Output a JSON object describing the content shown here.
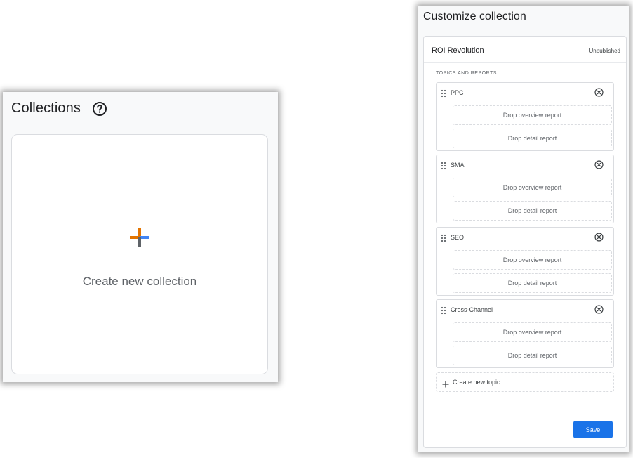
{
  "collections_panel": {
    "title": "Collections",
    "help_icon": "help-circle-icon",
    "create_card": {
      "label": "Create new collection",
      "icon": "multicolor-plus-icon"
    }
  },
  "customize_panel": {
    "title": "Customize collection",
    "collection": {
      "name": "ROI Revolution",
      "status": "Unpublished"
    },
    "section_label": "TOPICS AND REPORTS",
    "topics": [
      {
        "name": "PPC",
        "overview_drop": "Drop overview report",
        "detail_drop": "Drop detail report"
      },
      {
        "name": "SMA",
        "overview_drop": "Drop overview report",
        "detail_drop": "Drop detail report"
      },
      {
        "name": "SEO",
        "overview_drop": "Drop overview report",
        "detail_drop": "Drop detail report"
      },
      {
        "name": "Cross-Channel",
        "overview_drop": "Drop overview report",
        "detail_drop": "Drop detail report"
      }
    ],
    "create_topic_label": "Create new topic",
    "save_label": "Save"
  },
  "colors": {
    "accent": "#1a73e8",
    "plus_orange": "#e37400",
    "plus_blue": "#4285f4",
    "plus_gray": "#5f6368"
  }
}
